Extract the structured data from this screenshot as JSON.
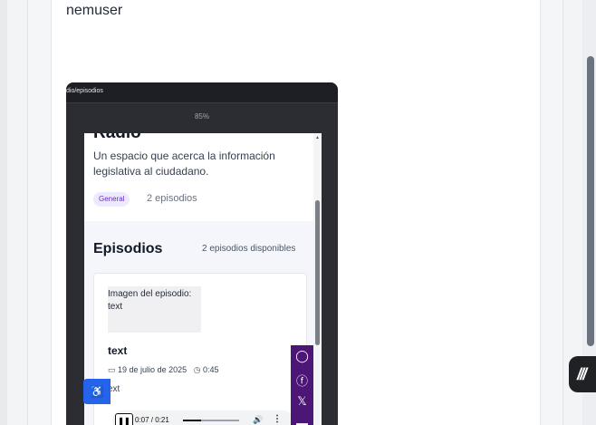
{
  "post": {
    "username": "nemuser"
  },
  "mock": {
    "url": "dio/episodios",
    "zoom": "85%",
    "radio": {
      "title": "Radio",
      "description": "Un espacio que acerca la información legislativa al ciudadano.",
      "tag": "General",
      "episode_count": "2 episodios"
    },
    "episodes": {
      "title": "Episodios",
      "available": "2 episodios disponibles",
      "items": [
        {
          "image_alt": "Imagen del episodio: text",
          "title": "text",
          "date": "19 de julio de 2025",
          "duration": "0:45",
          "text": "ext",
          "player": {
            "time": "0:07 / 0:21",
            "progress": 0.33
          }
        }
      ]
    },
    "share_icons": [
      "chat-icon",
      "facebook-icon",
      "x-icon"
    ]
  },
  "colors": {
    "accent": "#2563eb",
    "share_bar": "#4c1677",
    "tag_bg": "#ede9fe",
    "tag_text": "#6d28d9"
  }
}
